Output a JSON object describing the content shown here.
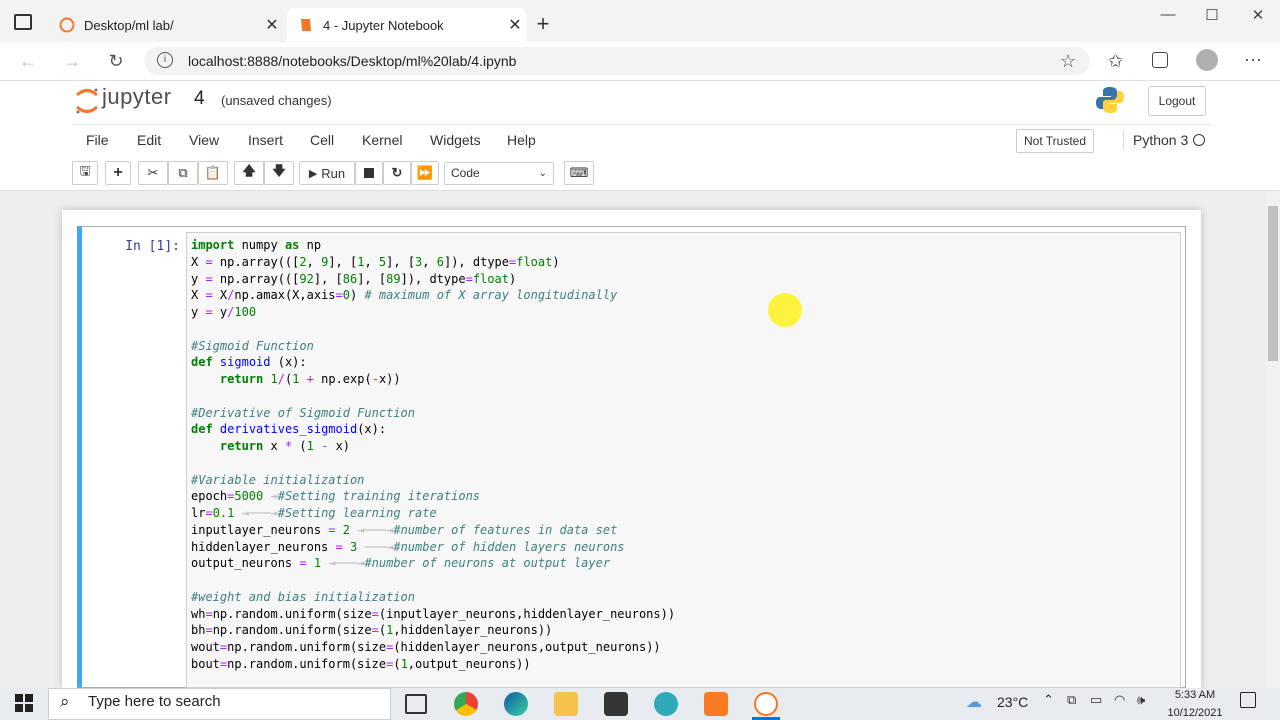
{
  "browser": {
    "tabs": [
      {
        "title": "Desktop/ml lab/"
      },
      {
        "title": "4 - Jupyter Notebook"
      }
    ],
    "url": "localhost:8888/notebooks/Desktop/ml%20lab/4.ipynb"
  },
  "jupyter": {
    "logo_text": "jupyter",
    "notebook_name": "4",
    "status": "(unsaved changes)",
    "logout_label": "Logout",
    "menu": [
      "File",
      "Edit",
      "View",
      "Insert",
      "Cell",
      "Kernel",
      "Widgets",
      "Help"
    ],
    "trust_label": "Not Trusted",
    "kernel_name": "Python 3",
    "toolbar": {
      "run_label": "Run",
      "cell_type": "Code"
    }
  },
  "cell": {
    "prompt": "In [1]:"
  },
  "taskbar": {
    "search_placeholder": "Type here to search",
    "temperature": "23°C",
    "time": "5:33 AM",
    "date": "10/12/2021"
  },
  "colors": {
    "cell_selected_border": "#42a5f5",
    "jupyter_orange": "#f37726",
    "prompt_blue": "#303f9f"
  }
}
